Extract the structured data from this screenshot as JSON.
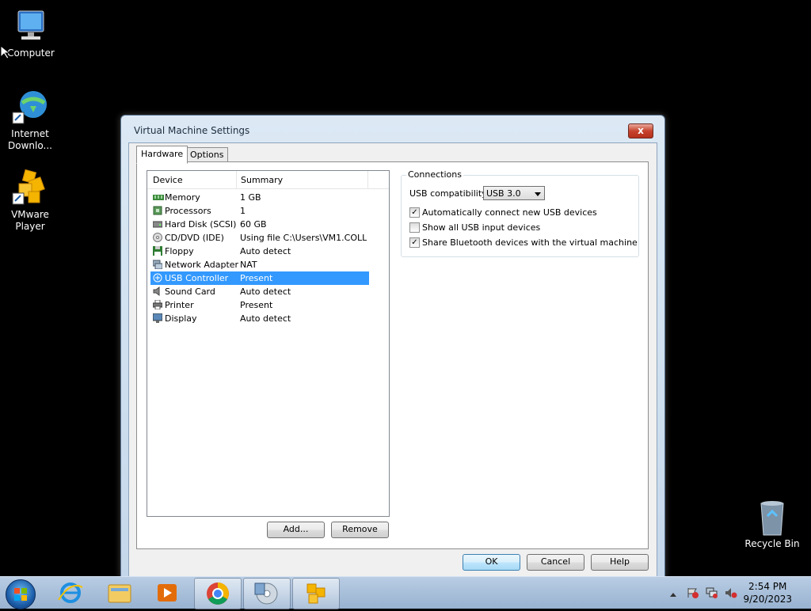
{
  "desktop": {
    "icons": [
      {
        "label": "Computer"
      },
      {
        "label": "Internet Downlo..."
      },
      {
        "label": "VMware Player"
      },
      {
        "label": "Recycle Bin"
      }
    ]
  },
  "window": {
    "title": "Virtual Machine Settings",
    "close_label": "x",
    "tabs": [
      {
        "label": "Hardware",
        "active": true
      },
      {
        "label": "Options",
        "active": false
      }
    ],
    "device_list": {
      "headers": {
        "device": "Device",
        "summary": "Summary"
      },
      "rows": [
        {
          "device": "Memory",
          "summary": "1 GB"
        },
        {
          "device": "Processors",
          "summary": "1"
        },
        {
          "device": "Hard Disk (SCSI)",
          "summary": "60 GB"
        },
        {
          "device": "CD/DVD (IDE)",
          "summary": "Using file C:\\Users\\VM1.COLL..."
        },
        {
          "device": "Floppy",
          "summary": "Auto detect"
        },
        {
          "device": "Network Adapter",
          "summary": "NAT"
        },
        {
          "device": "USB Controller",
          "summary": "Present",
          "selected": true
        },
        {
          "device": "Sound Card",
          "summary": "Auto detect"
        },
        {
          "device": "Printer",
          "summary": "Present"
        },
        {
          "device": "Display",
          "summary": "Auto detect"
        }
      ]
    },
    "add_label": "Add...",
    "remove_label": "Remove",
    "connections": {
      "label": "Connections",
      "usb_compat_label": "USB compatibility:",
      "usb_compat_value": "USB 3.0",
      "options": [
        {
          "label": "Automatically connect new USB devices",
          "checked": true
        },
        {
          "label": "Show all USB input devices",
          "checked": false
        },
        {
          "label": "Share Bluetooth devices with the virtual machine",
          "checked": true
        }
      ]
    },
    "buttons": {
      "ok": "OK",
      "cancel": "Cancel",
      "help": "Help"
    }
  },
  "taskbar": {
    "time": "2:54 PM",
    "date": "9/20/2023"
  }
}
